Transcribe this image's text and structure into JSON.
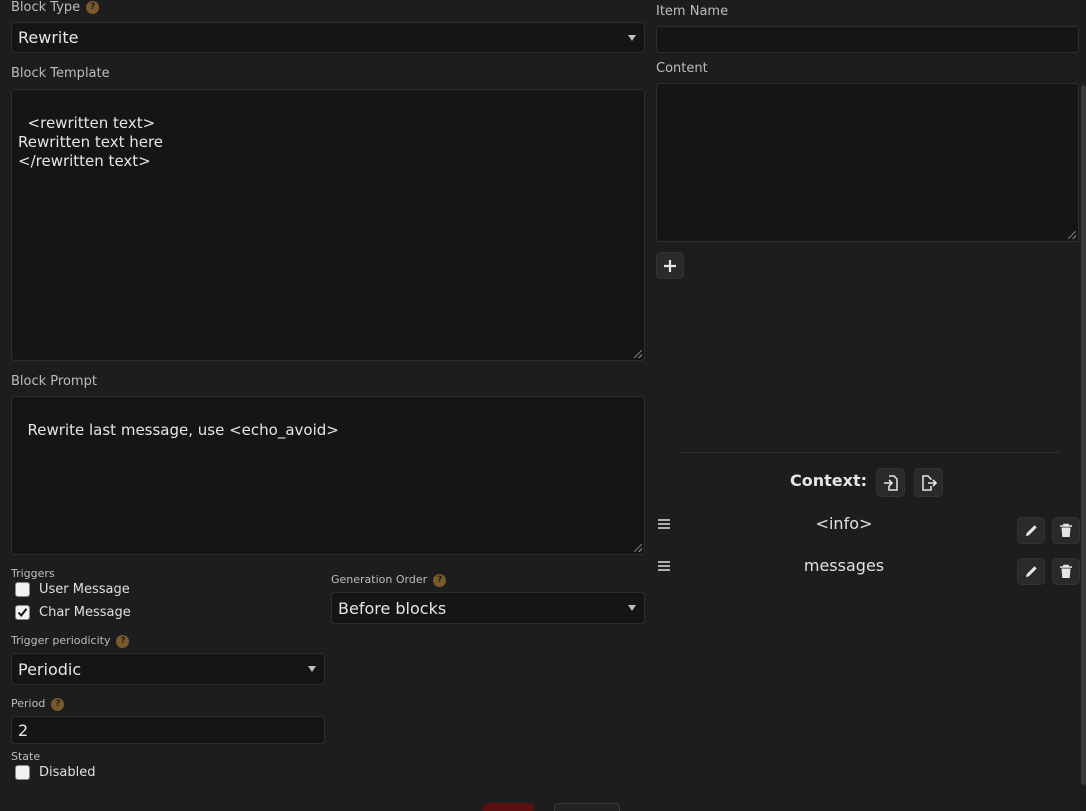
{
  "left": {
    "block_type": {
      "label": "Block Type",
      "help": "?",
      "value": "Rewrite"
    },
    "block_template": {
      "label": "Block Template",
      "value": "<rewritten text>\nRewritten text here\n</rewritten text>"
    },
    "block_prompt": {
      "label": "Block Prompt",
      "value": "Rewrite last message, use <echo_avoid>"
    },
    "triggers": {
      "label": "Triggers",
      "user_message": {
        "label": "User Message",
        "checked": false
      },
      "char_message": {
        "label": "Char Message",
        "checked": true
      }
    },
    "generation_order": {
      "label": "Generation Order",
      "help": "?",
      "value": "Before blocks"
    },
    "trigger_periodicity": {
      "label": "Trigger periodicity",
      "help": "?",
      "value": "Periodic"
    },
    "period": {
      "label": "Period",
      "help": "?",
      "value": "2"
    },
    "state": {
      "label": "State",
      "disabled": {
        "label": "Disabled",
        "checked": false
      }
    }
  },
  "right": {
    "item_name": {
      "label": "Item Name",
      "value": ""
    },
    "content": {
      "label": "Content",
      "value": ""
    },
    "add_icon": "plus-icon",
    "context": {
      "label": "Context:",
      "import_icon": "file-import-icon",
      "export_icon": "file-export-icon",
      "items": [
        {
          "label": "<info>"
        },
        {
          "label": "messages"
        }
      ]
    }
  },
  "colors": {
    "accent_help": "#7a5a2a",
    "background": "#1d1d1d",
    "field": "#151515"
  }
}
